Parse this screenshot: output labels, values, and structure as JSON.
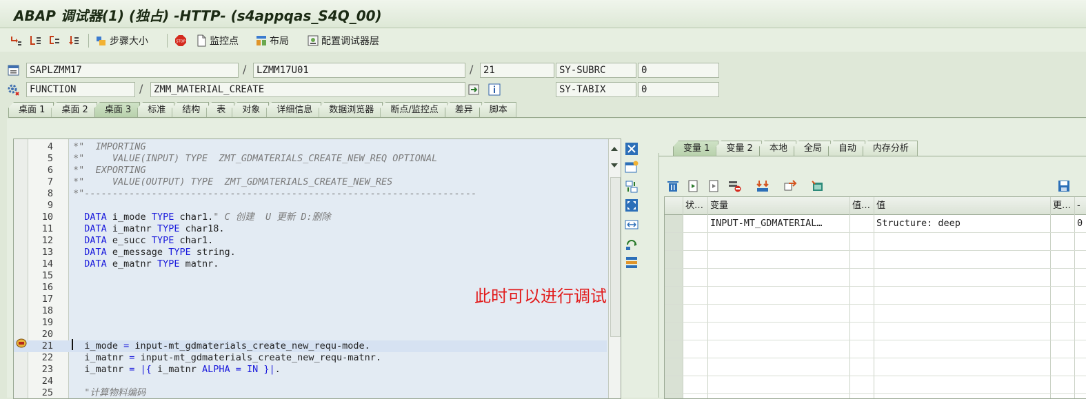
{
  "window": {
    "title": "ABAP 调试器(1) (独占) -HTTP- (s4appqas_S4Q_00)"
  },
  "toolbar": {
    "step_size": "步骤大小",
    "watchpoint": "监控点",
    "layout": "布局",
    "configure_layers": "配置调试器层"
  },
  "location": {
    "program": "SAPLZMM17",
    "include": "LZMM17U01",
    "line": "21",
    "event_type": "FUNCTION",
    "event_name": "ZMM_MATERIAL_CREATE",
    "sysfields": [
      {
        "name": "SY-SUBRC",
        "value": "0"
      },
      {
        "name": "SY-TABIX",
        "value": "0"
      }
    ]
  },
  "tabs": [
    "桌面 1",
    "桌面 2",
    "桌面 3",
    "标准",
    "结构",
    "表",
    "对象",
    "详细信息",
    "数据浏览器",
    "断点/监控点",
    "差异",
    "脚本"
  ],
  "active_tab": "桌面 3",
  "code": [
    {
      "n": "4",
      "t": "*\"  IMPORTING"
    },
    {
      "n": "5",
      "t": "*\"     VALUE(INPUT) TYPE  ZMT_GDMATERIALS_CREATE_NEW_REQ OPTIONAL"
    },
    {
      "n": "6",
      "t": "*\"  EXPORTING"
    },
    {
      "n": "7",
      "t": "*\"     VALUE(OUTPUT) TYPE  ZMT_GDMATERIALS_CREATE_NEW_RES"
    },
    {
      "n": "8",
      "t": "*\"----------------------------------------------------------------------"
    },
    {
      "n": "9",
      "t": ""
    },
    {
      "n": "10",
      "t": "  DATA i_mode TYPE char1.\" C 创建  U 更新 D:删除"
    },
    {
      "n": "11",
      "t": "  DATA i_matnr TYPE char18."
    },
    {
      "n": "12",
      "t": "  DATA e_succ TYPE char1."
    },
    {
      "n": "13",
      "t": "  DATA e_message TYPE string."
    },
    {
      "n": "14",
      "t": "  DATA e_matnr TYPE matnr."
    },
    {
      "n": "15",
      "t": ""
    },
    {
      "n": "16",
      "t": ""
    },
    {
      "n": "17",
      "t": ""
    },
    {
      "n": "18",
      "t": ""
    },
    {
      "n": "19",
      "t": ""
    },
    {
      "n": "20",
      "t": ""
    },
    {
      "n": "21",
      "t": "  i_mode = input-mt_gdmaterials_create_new_requ-mode."
    },
    {
      "n": "22",
      "t": "  i_matnr = input-mt_gdmaterials_create_new_requ-matnr."
    },
    {
      "n": "23",
      "t": "  i_matnr = |{ i_matnr ALPHA = IN }|."
    },
    {
      "n": "24",
      "t": ""
    },
    {
      "n": "25",
      "t": "  \"计算物料编码"
    }
  ],
  "current_line": "21",
  "annotation": "此时可以进行调试",
  "var_tabs": [
    "变量 1",
    "变量 2",
    "本地",
    "全局",
    "自动",
    "内存分析"
  ],
  "var_grid": {
    "headers": [
      "状…",
      "变量",
      "值…",
      "值",
      "更…",
      "-"
    ],
    "rows": [
      {
        "status": "",
        "name": "INPUT-MT_GDMATERIAL…",
        "vi": "",
        "value": "Structure: deep",
        "changed": "",
        "extra": "0"
      }
    ]
  }
}
